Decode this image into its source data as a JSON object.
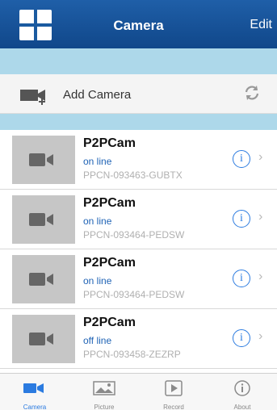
{
  "navbar": {
    "title": "Camera",
    "edit_label": "Edit",
    "grid_icon": "grid-icon"
  },
  "add_camera": {
    "label": "Add Camera",
    "icon": "camera-plus-icon",
    "refresh_icon": "refresh-icon"
  },
  "cameras": [
    {
      "name": "P2PCam",
      "status": "on line",
      "id": "PPCN-093463-GUBTX"
    },
    {
      "name": "P2PCam",
      "status": "on line",
      "id": "PPCN-093464-PEDSW"
    },
    {
      "name": "P2PCam",
      "status": "on line",
      "id": "PPCN-093464-PEDSW"
    },
    {
      "name": "P2PCam",
      "status": "off line",
      "id": "PPCN-093458-ZEZRP"
    }
  ],
  "tabs": [
    {
      "label": "Camera",
      "icon": "video-camera-icon",
      "active": true
    },
    {
      "label": "Picture",
      "icon": "picture-icon",
      "active": false
    },
    {
      "label": "Record",
      "icon": "play-icon",
      "active": false
    },
    {
      "label": "About",
      "icon": "info-icon",
      "active": false
    }
  ],
  "colors": {
    "navbar": "#1a58a0",
    "accent": "#2b7be0",
    "band": "#add8ea"
  }
}
